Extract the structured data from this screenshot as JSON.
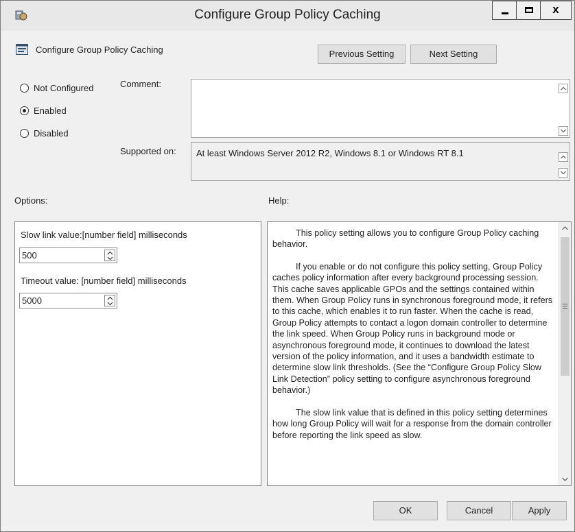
{
  "window": {
    "title": "Configure Group Policy Caching",
    "close_glyph": "x"
  },
  "header": {
    "policy_name": "Configure Group Policy Caching",
    "previous_label": "Previous Setting",
    "next_label": "Next Setting"
  },
  "state": {
    "options": [
      "Not Configured",
      "Enabled",
      "Disabled"
    ],
    "selected": "Enabled"
  },
  "comment": {
    "label": "Comment:",
    "value": ""
  },
  "supported": {
    "label": "Supported on:",
    "value": "At least Windows Server 2012 R2, Windows 8.1 or Windows RT 8.1"
  },
  "options_section": {
    "label": "Options:",
    "slow_link_label": "Slow link value:[number field] milliseconds",
    "slow_link_value": "500",
    "timeout_label": "Timeout value: [number field] milliseconds",
    "timeout_value": "5000"
  },
  "help_section": {
    "label": "Help:",
    "paragraphs": [
      "This policy setting allows you to configure Group Policy caching behavior.",
      "If you enable or do not configure this policy setting, Group Policy caches policy information after every background processing session. This cache saves applicable GPOs and the settings contained within them. When Group Policy runs in synchronous foreground mode, it refers to this cache, which enables it to run faster. When the cache is read, Group Policy attempts to contact a logon domain controller to determine the link speed. When Group Policy runs in background mode or asynchronous foreground mode, it continues to download the latest version of the policy information, and it uses a bandwidth estimate to determine slow link thresholds. (See the “Configure Group Policy Slow Link Detection” policy setting to configure asynchronous foreground behavior.)",
      "The slow link value that is defined in this policy setting determines how long Group Policy will wait for a response from the domain controller before reporting the link speed as slow."
    ]
  },
  "footer": {
    "ok_label": "OK",
    "cancel_label": "Cancel",
    "apply_label": "Apply"
  }
}
